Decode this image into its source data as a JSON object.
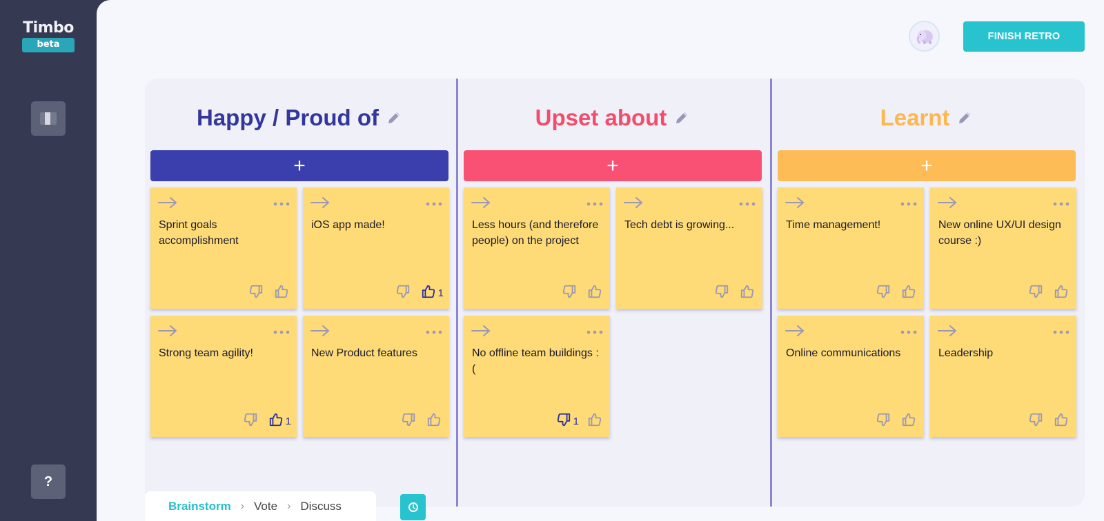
{
  "app": {
    "logo_text": "Timbo",
    "logo_badge": "beta"
  },
  "sidebar": {
    "panel_icon": "panel-toggle-icon",
    "help_label": "?"
  },
  "header": {
    "avatar_icon": "elephant-avatar-icon",
    "finish_label": "FINISH RETRO"
  },
  "columns": [
    {
      "title": "Happy / Proud of",
      "color": "#3b3ead",
      "title_color": "#33369a",
      "add_label": "+",
      "cards": [
        {
          "text": "Sprint goals accomplishment",
          "dislikes": "",
          "likes": ""
        },
        {
          "text": "iOS app made!",
          "dislikes": "",
          "likes": "1"
        },
        {
          "text": "Strong team agility!",
          "dislikes": "",
          "likes": "1"
        },
        {
          "text": "New Product features",
          "dislikes": "",
          "likes": ""
        }
      ]
    },
    {
      "title": "Upset about",
      "color": "#f95173",
      "title_color": "#f24d6c",
      "add_label": "+",
      "cards": [
        {
          "text": "Less hours (and therefore people) on the project",
          "dislikes": "",
          "likes": ""
        },
        {
          "text": "Tech debt is growing...",
          "dislikes": "",
          "likes": ""
        },
        {
          "text": "No offline team buildings :(",
          "dislikes": "1",
          "likes": ""
        }
      ]
    },
    {
      "title": "Learnt",
      "color": "#febc57",
      "title_color": "#fdb74f",
      "add_label": "+",
      "cards": [
        {
          "text": "Time management!",
          "dislikes": "",
          "likes": ""
        },
        {
          "text": "New online UX/UI design course :)",
          "dislikes": "",
          "likes": ""
        },
        {
          "text": "Online communications",
          "dislikes": "",
          "likes": ""
        },
        {
          "text": "Leadership",
          "dislikes": "",
          "likes": ""
        }
      ]
    }
  ],
  "phases": {
    "items": [
      "Brainstorm",
      "Vote",
      "Discuss"
    ],
    "active": "Brainstorm",
    "separator": "›"
  },
  "timer_icon": "clock-icon"
}
